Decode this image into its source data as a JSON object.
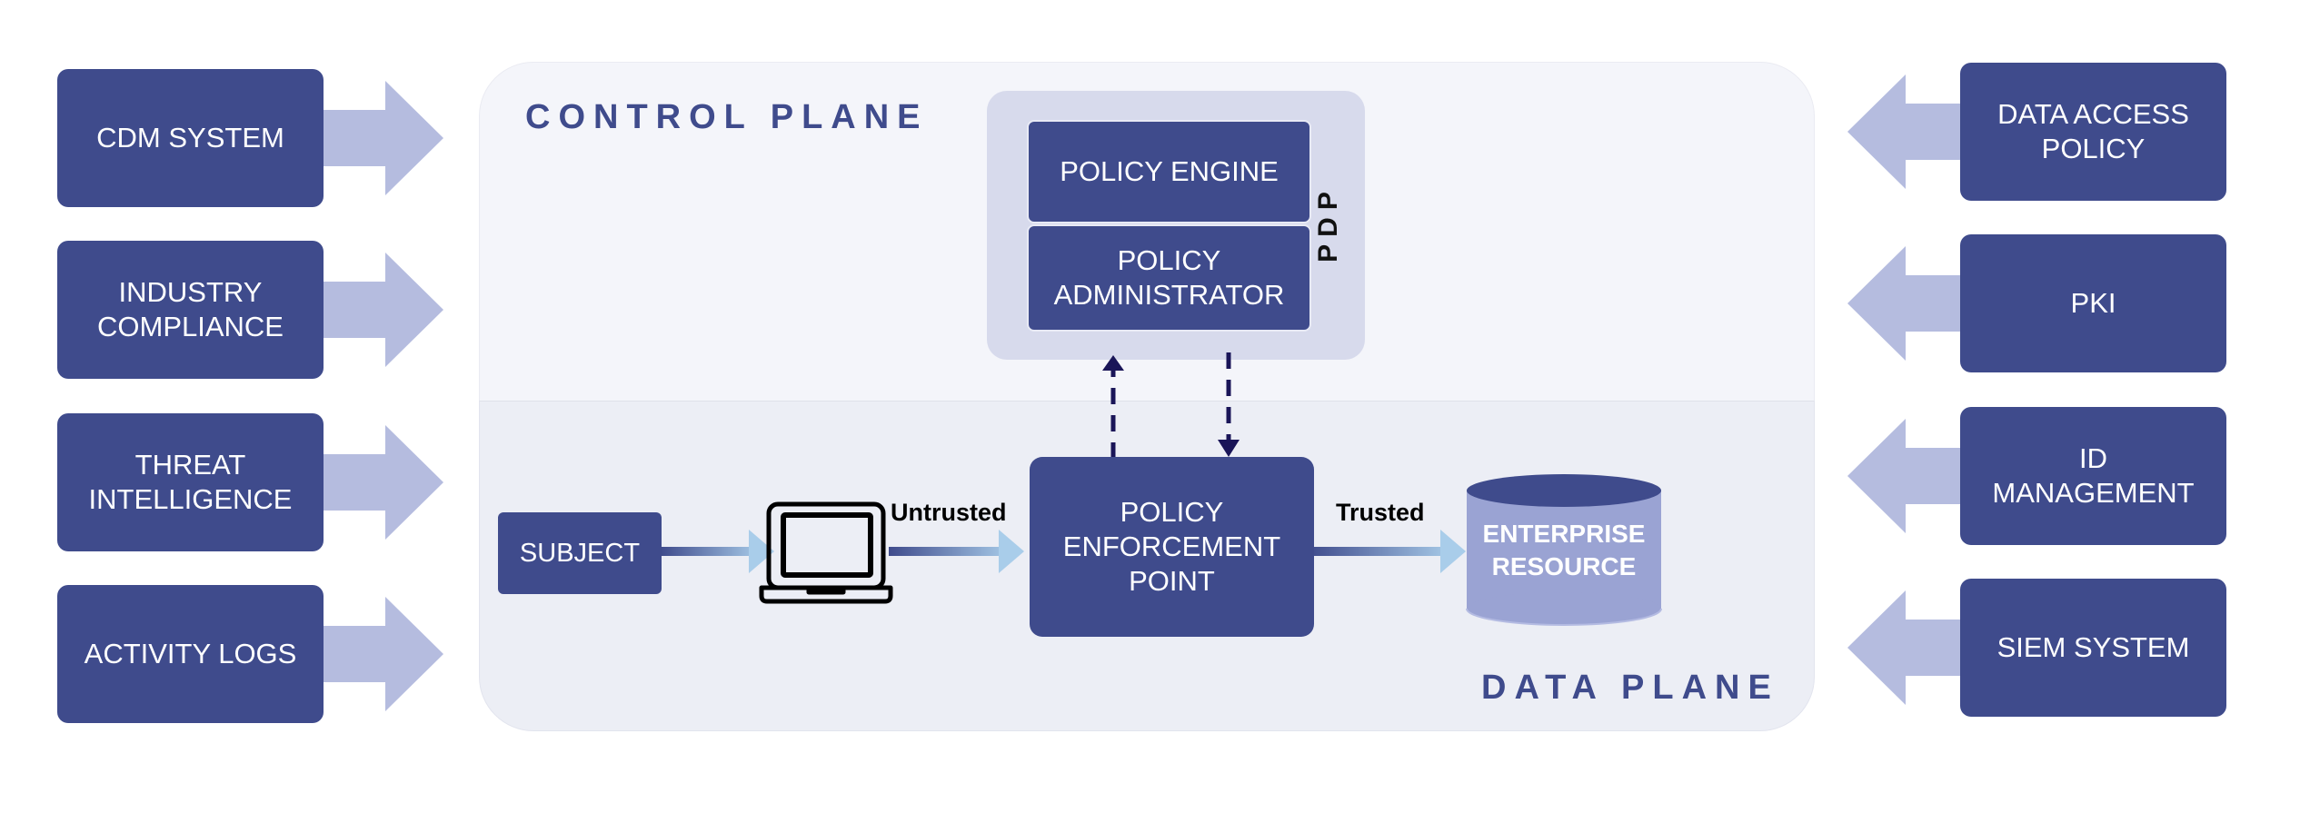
{
  "inputs_left": [
    {
      "label": "CDM SYSTEM"
    },
    {
      "label": "INDUSTRY\nCOMPLIANCE"
    },
    {
      "label": "THREAT\nINTELLIGENCE"
    },
    {
      "label": "ACTIVITY LOGS"
    }
  ],
  "inputs_right": [
    {
      "label": "DATA  ACCESS\nPOLICY"
    },
    {
      "label": "PKI"
    },
    {
      "label": "ID\nMANAGEMENT"
    },
    {
      "label": "SIEM SYSTEM"
    }
  ],
  "control_plane": {
    "title": "CONTROL PLANE",
    "pdp": {
      "label": "PDP",
      "policy_engine": "POLICY ENGINE",
      "policy_administrator": "POLICY\nADMINISTRATOR"
    }
  },
  "data_plane": {
    "title": "DATA PLANE",
    "subject": "SUBJECT",
    "device_icon": "laptop-icon",
    "untrusted_label": "Untrusted",
    "pep": "POLICY\nENFORCEMENT\nPOINT",
    "trusted_label": "Trusted",
    "resource": "ENTERPRISE\nRESOURCE"
  },
  "colors": {
    "box_fill": "#3f4b8c",
    "side_arrow": "#b5bcdf",
    "control_plane_bg": "#f4f5fa",
    "data_plane_bg": "#eceef5",
    "pdp_bg": "#d7daec",
    "dashed_arrow": "#1a1558",
    "flow_arrow_start": "#3f4b8c",
    "flow_arrow_end": "#a9cdea",
    "resource_body": "#9aa3d3"
  }
}
